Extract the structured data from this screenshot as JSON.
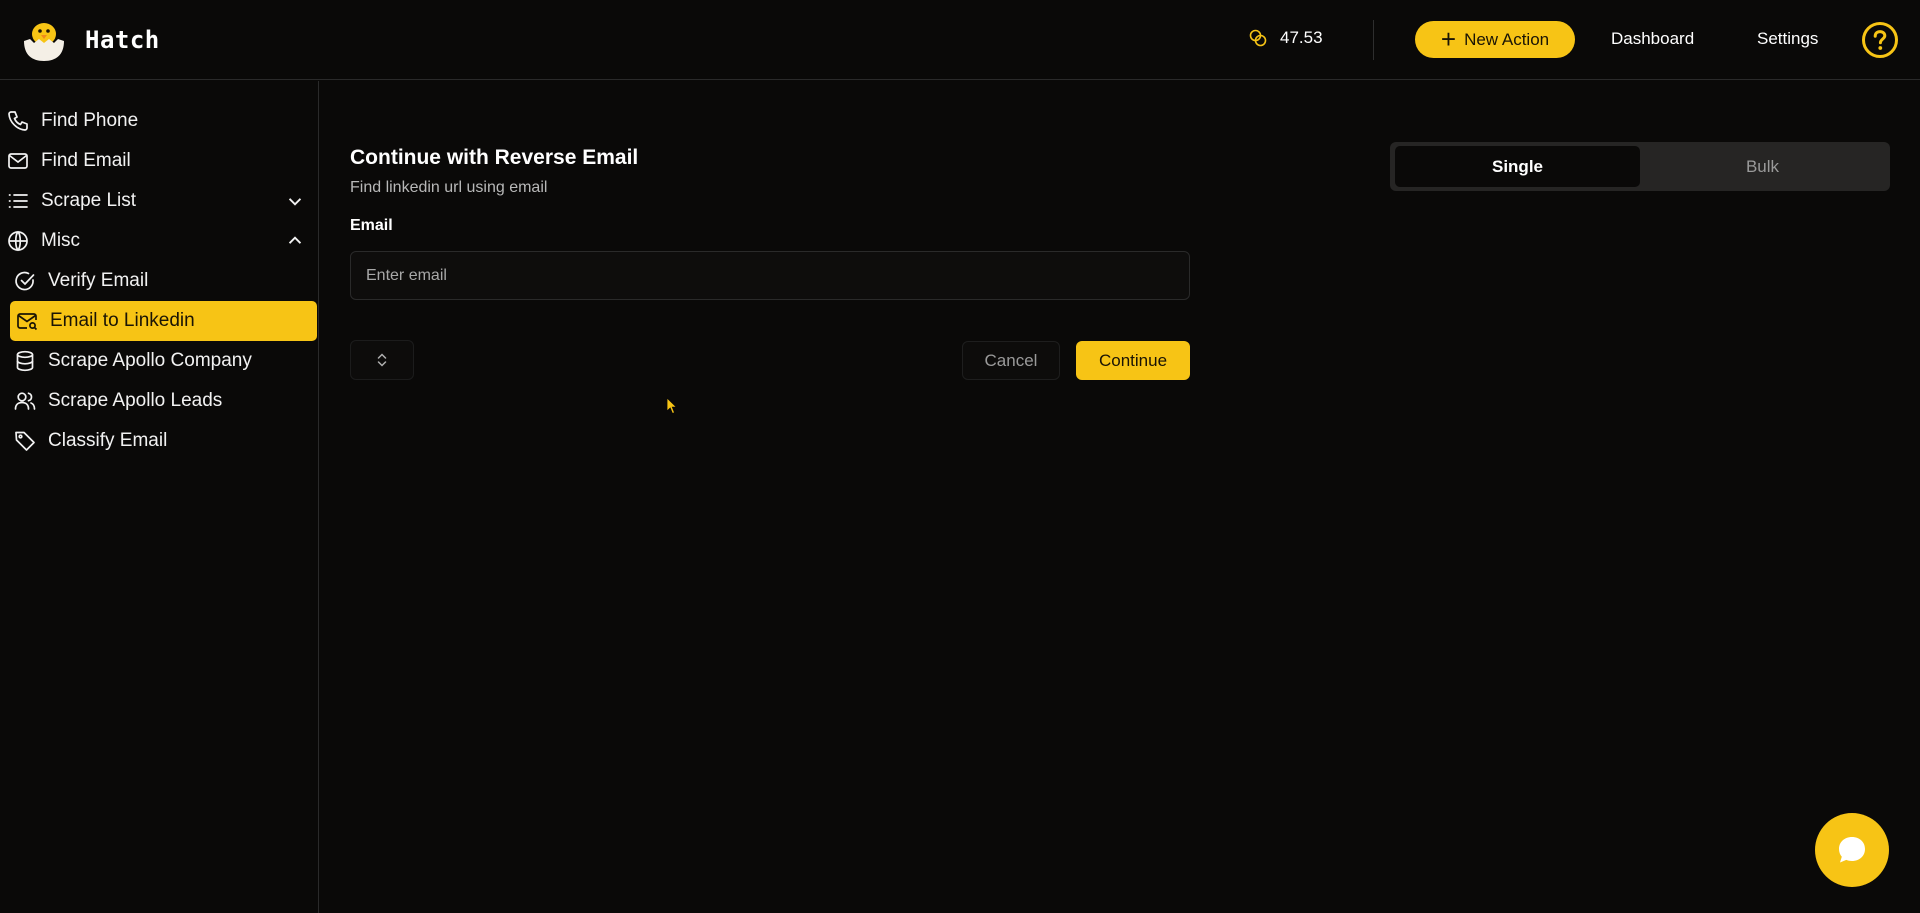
{
  "app": {
    "brand": "Hatch"
  },
  "header": {
    "credits": "47.53",
    "new_action_label": "New Action",
    "dashboard_label": "Dashboard",
    "settings_label": "Settings"
  },
  "sidebar": {
    "items": [
      {
        "label": "Find Phone",
        "icon": "phone-icon"
      },
      {
        "label": "Find Email",
        "icon": "mail-icon"
      },
      {
        "label": "Scrape List",
        "icon": "list-icon",
        "expanded": false
      },
      {
        "label": "Misc",
        "icon": "globe-icon",
        "expanded": true
      },
      {
        "label": "Verify Email",
        "icon": "check-circle-icon"
      },
      {
        "label": "Email to Linkedin",
        "icon": "mail-search-icon",
        "active": true
      },
      {
        "label": "Scrape Apollo Company",
        "icon": "database-icon"
      },
      {
        "label": "Scrape Apollo Leads",
        "icon": "users-icon"
      },
      {
        "label": "Classify Email",
        "icon": "tag-icon"
      }
    ]
  },
  "main": {
    "title": "Continue with Reverse Email",
    "subtitle": "Find linkedin url using email",
    "email_label": "Email",
    "email_placeholder": "Enter email",
    "email_value": "",
    "cancel_label": "Cancel",
    "continue_label": "Continue"
  },
  "mode_toggle": {
    "options": [
      "Single",
      "Bulk"
    ],
    "selected": "Single"
  },
  "colors": {
    "accent": "#f7c415",
    "background": "#0a0908",
    "border": "#2a2a2a"
  }
}
